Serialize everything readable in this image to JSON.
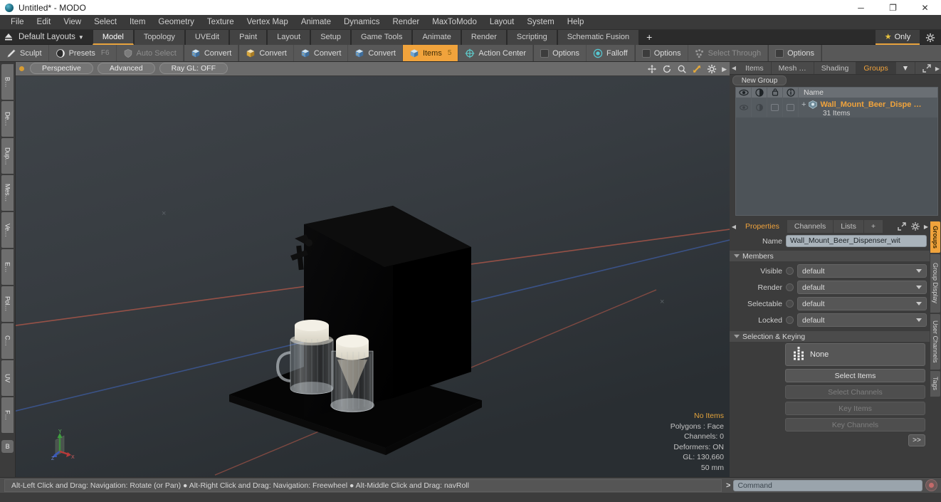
{
  "window": {
    "title": "Untitled* - MODO",
    "minimize_label": "─",
    "maximize_label": "❐",
    "close_label": "✕"
  },
  "menubar": {
    "items": [
      "File",
      "Edit",
      "View",
      "Select",
      "Item",
      "Geometry",
      "Texture",
      "Vertex Map",
      "Animate",
      "Dynamics",
      "Render",
      "MaxToModo",
      "Layout",
      "System",
      "Help"
    ]
  },
  "layoutbar": {
    "up_icon": "eject-icon",
    "default_layouts_label": "Default Layouts",
    "tabs": [
      {
        "label": "Model",
        "active": true
      },
      {
        "label": "Topology",
        "active": false
      },
      {
        "label": "UVEdit",
        "active": false
      },
      {
        "label": "Paint",
        "active": false
      },
      {
        "label": "Layout",
        "active": false
      },
      {
        "label": "Setup",
        "active": false
      },
      {
        "label": "Game Tools",
        "active": false
      },
      {
        "label": "Animate",
        "active": false
      },
      {
        "label": "Render",
        "active": false
      },
      {
        "label": "Scripting",
        "active": false
      },
      {
        "label": "Schematic Fusion",
        "active": false
      }
    ],
    "add_tab_label": "+",
    "only_label": "Only",
    "accent": "#e8a33d"
  },
  "toolbar": {
    "items": [
      {
        "label": "Sculpt",
        "icon": "brush-icon",
        "hotkey": "",
        "state": "normal"
      },
      {
        "label": "Presets",
        "icon": "sphere-icon",
        "hotkey": "F6",
        "state": "normal"
      },
      {
        "label": "Auto Select",
        "icon": "shield-icon",
        "hotkey": "",
        "state": "dim"
      },
      {
        "label": "Convert",
        "icon": "cube-blue-icon",
        "hotkey": "",
        "state": "normal"
      },
      {
        "label": "Convert",
        "icon": "cube-yellow-icon",
        "hotkey": "",
        "state": "normal"
      },
      {
        "label": "Convert",
        "icon": "cube-blue2-icon",
        "hotkey": "",
        "state": "normal"
      },
      {
        "label": "Convert",
        "icon": "cube-blue3-icon",
        "hotkey": "",
        "state": "normal"
      },
      {
        "label": "Items",
        "icon": "items-cube-icon",
        "hotkey": "5",
        "state": "active"
      },
      {
        "label": "Action Center",
        "icon": "crosshair-icon",
        "hotkey": "",
        "state": "normal"
      },
      {
        "label": "Options",
        "icon": "checkbox-icon",
        "hotkey": "",
        "state": "normal"
      },
      {
        "label": "Falloff",
        "icon": "target-icon",
        "hotkey": "",
        "state": "normal"
      },
      {
        "label": "Options",
        "icon": "checkbox-icon",
        "hotkey": "",
        "state": "normal"
      },
      {
        "label": "Select Through",
        "icon": "cluster-icon",
        "hotkey": "",
        "state": "dim"
      },
      {
        "label": "Options",
        "icon": "checkbox-icon",
        "hotkey": "",
        "state": "normal"
      }
    ]
  },
  "left_strip": {
    "tabs": [
      "B…",
      "De…",
      "Dup…",
      "Mes…",
      "Ve…",
      "E…",
      "Pol…",
      "C…",
      "UV",
      "F…"
    ],
    "bottom_tab": "B"
  },
  "viewport": {
    "header": {
      "projection": "Perspective",
      "shading": "Advanced",
      "raygl": "Ray GL: OFF",
      "icons": [
        "move-icon",
        "rotate-icon",
        "zoom-icon",
        "fit-icon",
        "gear-icon",
        "chevron-right-icon"
      ]
    },
    "stats": {
      "selection": "No Items",
      "polygons": "Polygons : Face",
      "channels": "Channels: 0",
      "deformers": "Deformers: ON",
      "gl": "GL: 130,660",
      "scale": "50 mm"
    },
    "axis_labels": {
      "x": "X",
      "y": "Y",
      "z": "Z"
    }
  },
  "right_panel": {
    "top_tabs": [
      {
        "label": "Items",
        "active": false
      },
      {
        "label": "Mesh …",
        "active": false
      },
      {
        "label": "Shading",
        "active": false
      },
      {
        "label": "Groups",
        "active": true
      }
    ],
    "top_tabs_more": "▼",
    "expand_icon": "expand-icon",
    "chevron_icon": "chevron-right-icon",
    "new_group_label": "New Group",
    "list": {
      "columns": [
        "eye-icon",
        "render-icon",
        "lock-icon",
        "info-icon"
      ],
      "name_header": "Name",
      "rows": [
        {
          "name": "Wall_Mount_Beer_Dispe …",
          "subtitle": "31 Items",
          "expander": "+",
          "icon": "group-icon"
        }
      ]
    },
    "properties": {
      "tabs": [
        {
          "label": "Properties",
          "active": true
        },
        {
          "label": "Channels",
          "active": false
        },
        {
          "label": "Lists",
          "active": false
        },
        {
          "label": "+",
          "active": false
        }
      ],
      "name_label": "Name",
      "name_value": "Wall_Mount_Beer_Dispenser_wit",
      "members_section": "Members",
      "members": [
        {
          "label": "Visible",
          "value": "default"
        },
        {
          "label": "Render",
          "value": "default"
        },
        {
          "label": "Selectable",
          "value": "default"
        },
        {
          "label": "Locked",
          "value": "default"
        }
      ],
      "selection_section": "Selection & Keying",
      "none_label": "None",
      "none_icon": "dots-grid-icon",
      "buttons": [
        {
          "label": "Select Items",
          "enabled": true
        },
        {
          "label": "Select Channels",
          "enabled": false
        },
        {
          "label": "Key Items",
          "enabled": false
        },
        {
          "label": "Key Channels",
          "enabled": false
        }
      ],
      "more_label": ">>"
    },
    "side_tabs": [
      {
        "label": "Groups",
        "active": true
      },
      {
        "label": "Group Display",
        "active": false
      },
      {
        "label": "User Channels",
        "active": false
      },
      {
        "label": "Tags",
        "active": false
      }
    ]
  },
  "statusbar": {
    "hint": "Alt-Left Click and Drag: Navigation: Rotate (or Pan) ● Alt-Right Click and Drag: Navigation: Freewheel ● Alt-Middle Click and Drag: navRoll",
    "command_prompt": ">",
    "command_placeholder": "Command",
    "record_icon": "record-icon"
  }
}
